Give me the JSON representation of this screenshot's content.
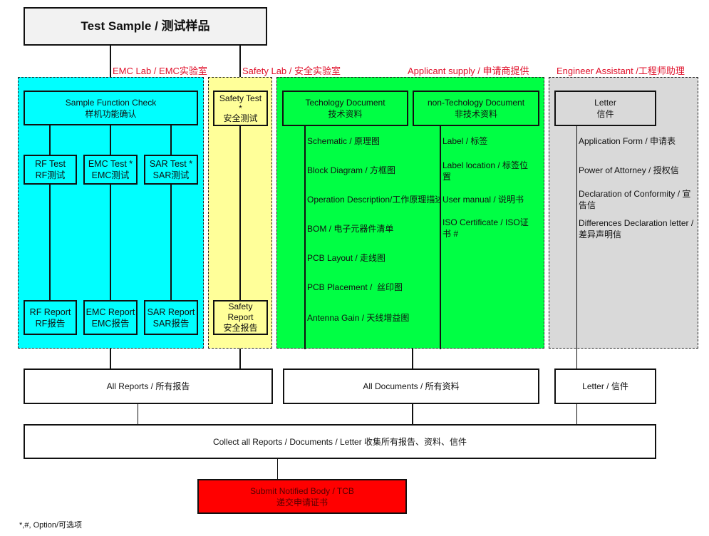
{
  "title": "Test Sample / 测试样品",
  "sections": {
    "emc_lab": "EMC Lab / EMC实验室",
    "safety_lab": "Safety Lab / 安全实验室",
    "applicant": "Applicant supply / 申请商提供",
    "engineer": "Engineer Assistant /工程师助理"
  },
  "emc": {
    "function_check": {
      "en": "Sample Function Check",
      "zh": "样机功能确认"
    },
    "tests": [
      {
        "en": "RF Test",
        "zh": "RF测试"
      },
      {
        "en": "EMC Test *",
        "zh": "EMC测试"
      },
      {
        "en": "SAR Test *",
        "zh": "SAR测试"
      }
    ],
    "reports": [
      {
        "en": "RF Report",
        "zh": "RF报告"
      },
      {
        "en": "EMC Report",
        "zh": "EMC报告"
      },
      {
        "en": "SAR Report",
        "zh": "SAR报告"
      }
    ]
  },
  "safety": {
    "test": {
      "en": "Safety Test",
      "mark": "*",
      "zh": "安全测试"
    },
    "report": {
      "en1": "Safety",
      "en2": "Report",
      "zh": "安全报告"
    }
  },
  "applicant": {
    "tech_doc": {
      "en": "Techology Document",
      "zh": "技术资料"
    },
    "non_tech_doc": {
      "en": "non-Techology Document",
      "zh": "非技术资料"
    },
    "tech_items": [
      "Schematic / 原理图",
      "Block Diagram / 方框图",
      "Operation Description/工作原理描述",
      "BOM / 电子元器件清单",
      "PCB Layout / 走线图",
      "PCB Placement /  丝印图",
      "Antenna Gain / 天线增益图"
    ],
    "non_tech_items": [
      "Label / 标签",
      "Label location / 标签位置",
      "User manual / 说明书",
      "ISO Certificate / ISO证书 #"
    ]
  },
  "engineer": {
    "letter": {
      "en": "Letter",
      "zh": "信件"
    },
    "items": [
      "Application Form / 申请表",
      "Power of Attorney / 授权信",
      "Declaration of Conformity / 宣告信",
      "Differences Declaration letter / 差异声明信"
    ]
  },
  "summary": {
    "all_reports": "All Reports / 所有报告",
    "all_documents": "All Documents / 所有资料",
    "letter": "Letter / 信件",
    "collect": "Collect all Reports / Documents / Letter 收集所有报告、资料、信件"
  },
  "submit": {
    "en": "Submit Notified Body / TCB",
    "zh": "递交申请证书"
  },
  "footnote": "*,#, Option/可选项",
  "colors": {
    "emc_zone": "#00ffff",
    "safety_zone": "#ffff99",
    "applicant_zone": "#00ff44",
    "engineer_zone": "#d9d9d9",
    "submit": "#ff0000",
    "section_label": "#e0112b"
  }
}
